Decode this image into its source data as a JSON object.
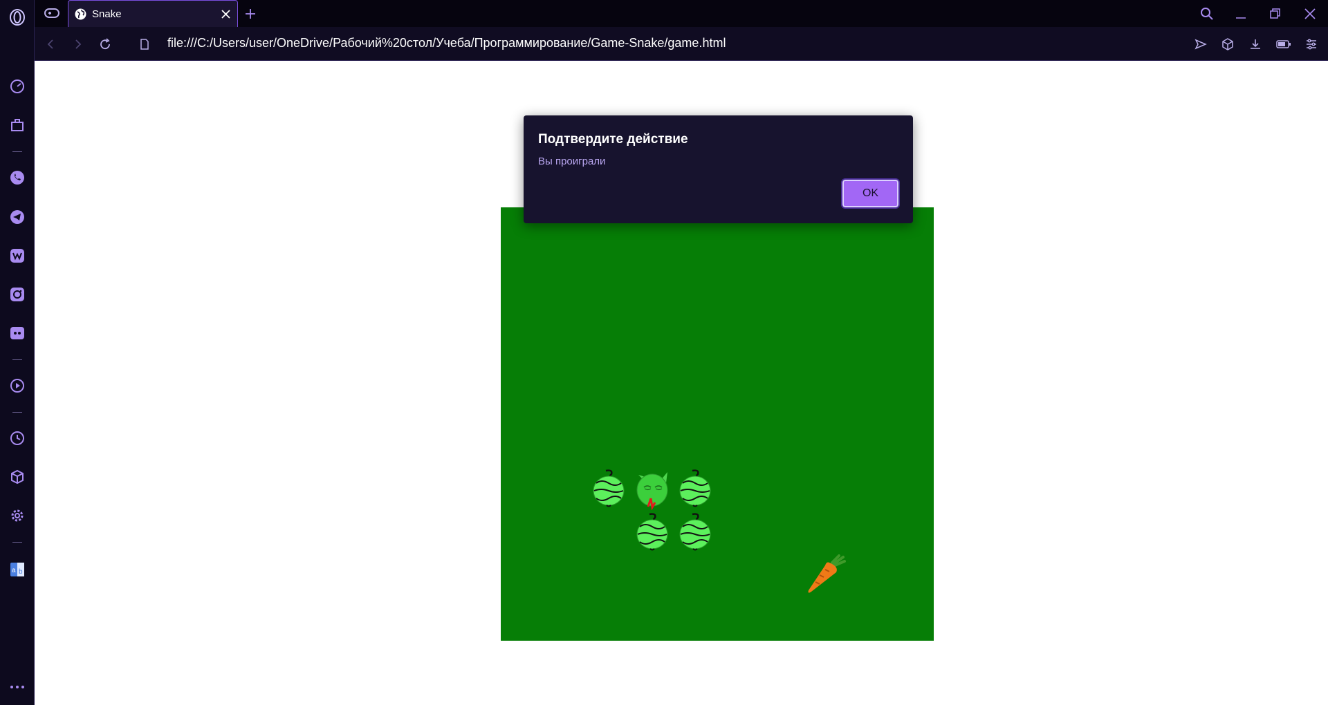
{
  "browser": {
    "tab": {
      "title": "Snake"
    },
    "address_bar": {
      "url": "file:///C:/Users/user/OneDrive/Рабочий%20стол/Учеба/Программирование/Game-Snake/game.html"
    }
  },
  "sidebar": {
    "items": [
      "opera-logo",
      "speed-dial-icon",
      "briefcase-icon",
      "whatsapp-icon",
      "telegram-icon",
      "vk-icon",
      "instagram-icon",
      "discord-icon",
      "player-icon",
      "history-icon",
      "extensions-icon",
      "settings-icon",
      "translate-icon",
      "more-icon"
    ]
  },
  "dialog": {
    "title": "Подтвердите действие",
    "message": "Вы проиграли",
    "ok_label": "OK"
  },
  "game": {
    "board_color": "#067e06",
    "grid": {
      "cols": 10,
      "rows": 10
    },
    "snake_head": {
      "col": 3,
      "row": 6
    },
    "snake_body": [
      {
        "col": 2,
        "row": 6
      },
      {
        "col": 4,
        "row": 6
      },
      {
        "col": 3,
        "row": 7
      },
      {
        "col": 4,
        "row": 7
      }
    ],
    "food": {
      "type": "carrot",
      "col": 7,
      "row": 8
    }
  },
  "colors": {
    "accent": "#a267f5",
    "tab_border": "#7b4fe0",
    "sidebar_icon": "#a88bf0"
  }
}
